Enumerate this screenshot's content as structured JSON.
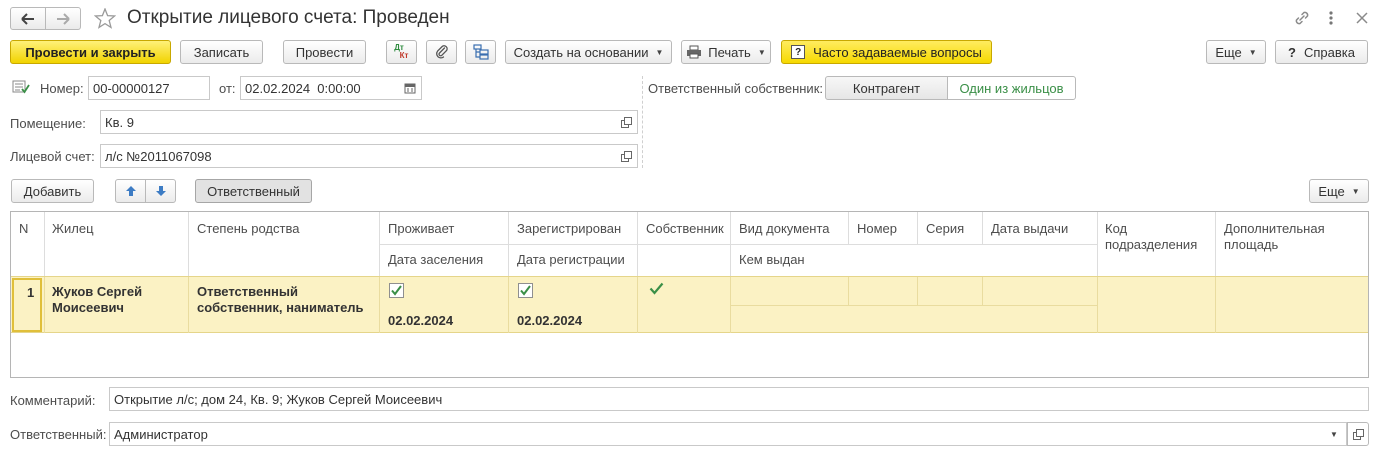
{
  "window": {
    "title": "Открытие лицевого счета: Проведен"
  },
  "toolbar": {
    "post_close": "Провести и закрыть",
    "save": "Записать",
    "post": "Провести",
    "dt_kt_top": "Дт",
    "dt_kt_bottom": "Кт",
    "create_based": "Создать на основании",
    "print": "Печать",
    "faq": "Часто задаваемые вопросы",
    "more": "Еще",
    "help": "Справка"
  },
  "header": {
    "number_label": "Номер:",
    "number_value": "00-00000127",
    "date_label": "от:",
    "date_value": "02.02.2024  0:00:00",
    "premises_label": "Помещение:",
    "premises_value": "Кв. 9",
    "account_label": "Лицевой счет:",
    "account_value": "л/с №2011067098",
    "owner_label": "Ответственный собственник:",
    "owner_options": [
      "Контрагент",
      "Один из жильцов"
    ],
    "owner_selected": "Один из жильцов"
  },
  "table_toolbar": {
    "add": "Добавить",
    "responsible": "Ответственный",
    "more": "Еще"
  },
  "table": {
    "columns": {
      "n": "N",
      "resident": "Жилец",
      "kinship": "Степень родства",
      "lives": "Проживает",
      "move_in_date": "Дата заселения",
      "registered": "Зарегистрирован",
      "reg_date": "Дата регистрации",
      "owner": "Собственник",
      "doc_type": "Вид документа",
      "doc_number": "Номер",
      "doc_series": "Серия",
      "issue_date": "Дата выдачи",
      "issued_by": "Кем выдан",
      "dept_code": "Код подразделения",
      "extra_area": "Дополнительная площадь"
    },
    "rows": [
      {
        "n": "1",
        "resident": "Жуков Сергей Моисеевич",
        "kinship": "Ответственный собственник, наниматель",
        "lives": true,
        "move_in_date": "02.02.2024",
        "registered": true,
        "reg_date": "02.02.2024",
        "owner": true,
        "doc_type": "",
        "doc_number": "",
        "doc_series": "",
        "issue_date": "",
        "issued_by": "",
        "dept_code": "",
        "extra_area": ""
      }
    ]
  },
  "footer": {
    "comment_label": "Комментарий:",
    "comment_value": "Открытие л/с; дом 24, Кв. 9; Жуков Сергей Моисеевич",
    "responsible_label": "Ответственный:",
    "responsible_value": "Администратор"
  },
  "colors": {
    "primary_button": "#f1d300",
    "selected_row": "#fbf2c4",
    "check_green": "#3a8f47",
    "toggle_active_text": "#3a8f47"
  }
}
